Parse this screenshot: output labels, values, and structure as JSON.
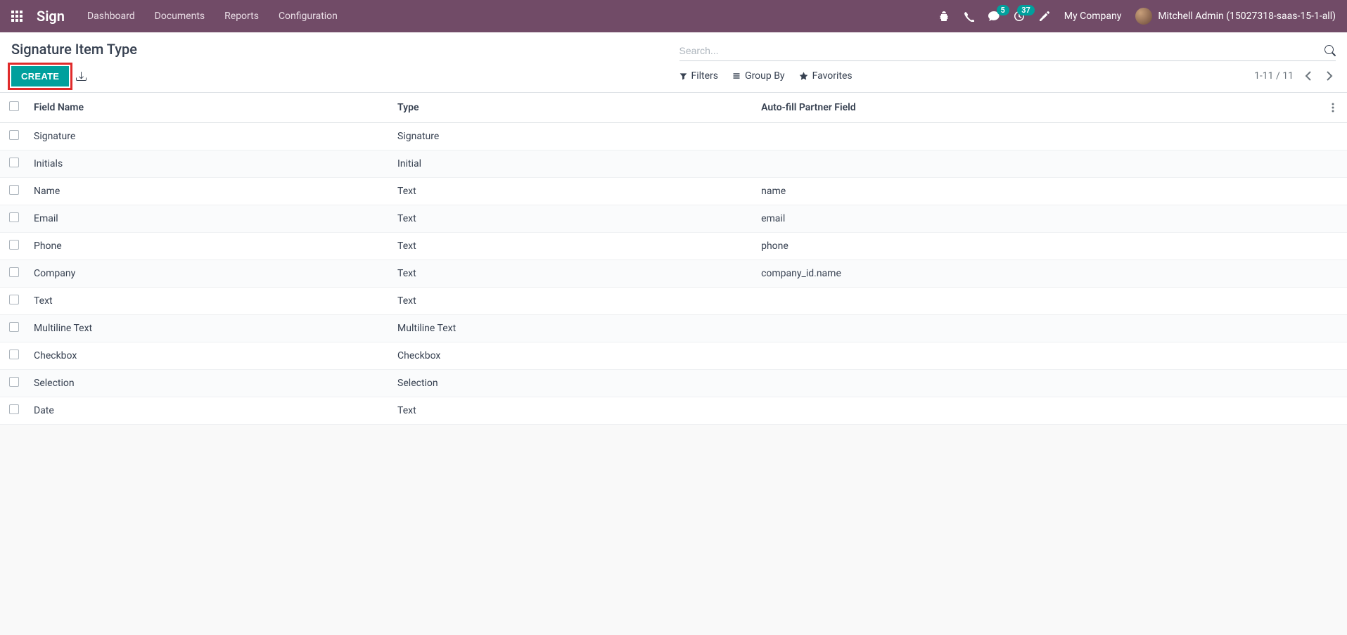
{
  "navbar": {
    "brand": "Sign",
    "menu": [
      {
        "label": "Dashboard"
      },
      {
        "label": "Documents"
      },
      {
        "label": "Reports"
      },
      {
        "label": "Configuration"
      }
    ],
    "messages_badge": "5",
    "activities_badge": "37",
    "company": "My Company",
    "user": "Mitchell Admin (15027318-saas-15-1-all)"
  },
  "control_panel": {
    "title": "Signature Item Type",
    "create_label": "CREATE",
    "search_placeholder": "Search...",
    "filters_label": "Filters",
    "groupby_label": "Group By",
    "favorites_label": "Favorites",
    "pager": "1-11 / 11"
  },
  "table": {
    "columns": {
      "field_name": "Field Name",
      "type": "Type",
      "autofill": "Auto-fill Partner Field"
    },
    "rows": [
      {
        "name": "Signature",
        "type": "Signature",
        "autofill": ""
      },
      {
        "name": "Initials",
        "type": "Initial",
        "autofill": ""
      },
      {
        "name": "Name",
        "type": "Text",
        "autofill": "name"
      },
      {
        "name": "Email",
        "type": "Text",
        "autofill": "email"
      },
      {
        "name": "Phone",
        "type": "Text",
        "autofill": "phone"
      },
      {
        "name": "Company",
        "type": "Text",
        "autofill": "company_id.name"
      },
      {
        "name": "Text",
        "type": "Text",
        "autofill": ""
      },
      {
        "name": "Multiline Text",
        "type": "Multiline Text",
        "autofill": ""
      },
      {
        "name": "Checkbox",
        "type": "Checkbox",
        "autofill": ""
      },
      {
        "name": "Selection",
        "type": "Selection",
        "autofill": ""
      },
      {
        "name": "Date",
        "type": "Text",
        "autofill": ""
      }
    ]
  }
}
